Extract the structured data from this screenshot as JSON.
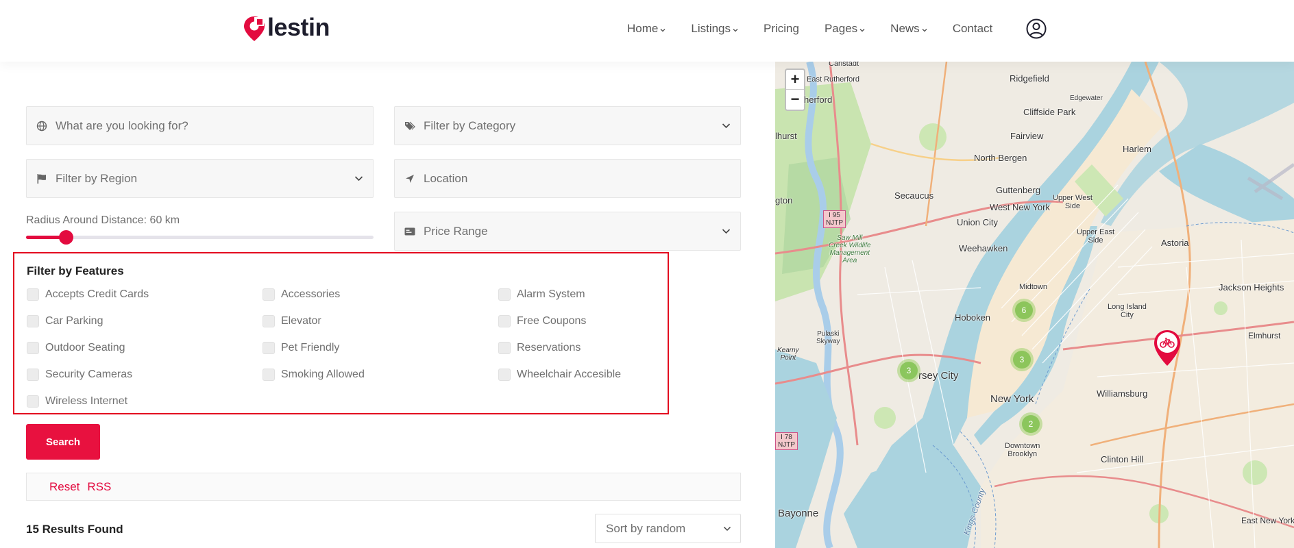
{
  "brand": {
    "name": "lestin",
    "accent": "#e30b3f"
  },
  "nav": {
    "items": [
      {
        "label": "Home",
        "dropdown": true
      },
      {
        "label": "Listings",
        "dropdown": true
      },
      {
        "label": "Pricing",
        "dropdown": false
      },
      {
        "label": "Pages",
        "dropdown": true
      },
      {
        "label": "News",
        "dropdown": true
      },
      {
        "label": "Contact",
        "dropdown": false
      }
    ],
    "user_icon": "user-circle-icon"
  },
  "filters": {
    "keyword_placeholder": "What are you looking for?",
    "category_placeholder": "Filter by Category",
    "region_placeholder": "Filter by Region",
    "location_placeholder": "Location",
    "price_placeholder": "Price Range",
    "radius_label": "Radius Around Distance: 60 km",
    "radius_fraction": 0.115
  },
  "features": {
    "title": "Filter by Features",
    "items": [
      "Accepts Credit Cards",
      "Accessories",
      "Alarm System",
      "Car Parking",
      "Elevator",
      "Free Coupons",
      "Outdoor Seating",
      "Pet Friendly",
      "Reservations",
      "Security Cameras",
      "Smoking Allowed",
      "Wheelchair Accesible",
      "Wireless Internet"
    ]
  },
  "actions": {
    "search_label": "Search",
    "reset_label": "Reset",
    "rss_label": "RSS"
  },
  "results": {
    "count_text": "15 Results Found",
    "sort_label": "Sort by random"
  },
  "map": {
    "zoom_in": "+",
    "zoom_out": "−",
    "clusters": [
      "6",
      "3",
      "3",
      "2"
    ],
    "labels": {
      "carlstadt": "Carlstadt",
      "east_rutherford": "East Rutherford",
      "rutherford": "herford",
      "ridgefield": "Ridgefield",
      "cliffside": "Cliffside Park",
      "edgewater": "Edgewater",
      "fairview": "Fairview",
      "lyndhurst": "lhurst",
      "north_bergen": "North Bergen",
      "harlem": "Harlem",
      "secaucus": "Secaucus",
      "guttenberg": "Guttenberg",
      "west_new_york": "West New York",
      "upper_west": "Upper West\nSide",
      "lington": "gton",
      "union_city": "Union City",
      "upper_east": "Upper East\nSide",
      "astoria": "Astoria",
      "weehawken": "Weehawken",
      "jackson_heights": "Jackson Heights",
      "midtown": "Midtown",
      "long_island": "Long Island\nCity",
      "hoboken": "Hoboken",
      "elmhurst": "Elmhurst",
      "pulaski": "Pulaski\nSkyway",
      "kearny": "Kearny\nPoint",
      "jersey_city": "rsey City",
      "williamsburg": "Williamsburg",
      "new_york": "New York",
      "downtown": "Downtown\nBrooklyn",
      "clinton_hill": "Clinton Hill",
      "bayonne": "Bayonne",
      "east_new_york": "East New York",
      "sawmill": "Saw Mill\nCreek Wildlife\nManagement\nArea",
      "kings_county": "Kings County"
    },
    "shields": {
      "i95": "I 95\nNJTP",
      "i78": "I 78\nNJTP"
    }
  }
}
